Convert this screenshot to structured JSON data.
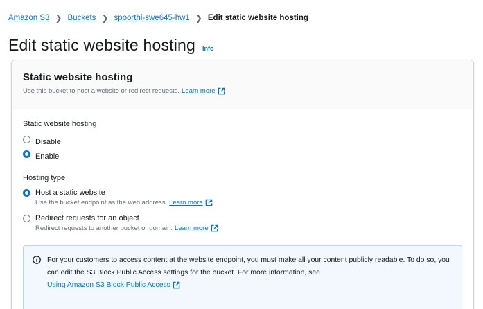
{
  "breadcrumb": {
    "items": [
      "Amazon S3",
      "Buckets",
      "spoorthi-swe645-hw1"
    ],
    "current": "Edit static website hosting"
  },
  "page": {
    "title": "Edit static website hosting",
    "info_label": "Info"
  },
  "panel": {
    "title": "Static website hosting",
    "description": "Use this bucket to host a website or redirect requests.",
    "learn_more": "Learn more"
  },
  "hosting": {
    "label": "Static website hosting",
    "options": [
      "Disable",
      "Enable"
    ],
    "selected": "Enable"
  },
  "hosting_type": {
    "label": "Hosting type",
    "options": [
      {
        "label": "Host a static website",
        "description": "Use the bucket endpoint as the web address.",
        "learn_more": "Learn more"
      },
      {
        "label": "Redirect requests for an object",
        "description": "Redirect requests to another bucket or domain.",
        "learn_more": "Learn more"
      }
    ],
    "selected": "Host a static website"
  },
  "alert": {
    "text": "For your customers to access content at the website endpoint, you must make all your content publicly readable. To do so, you can edit the S3 Block Public Access settings for the bucket. For more information, see",
    "link": "Using Amazon S3 Block Public Access"
  },
  "colors": {
    "link": "#0972d3",
    "info_bg": "#f2f8fd",
    "info_border": "#b5d6f4"
  }
}
